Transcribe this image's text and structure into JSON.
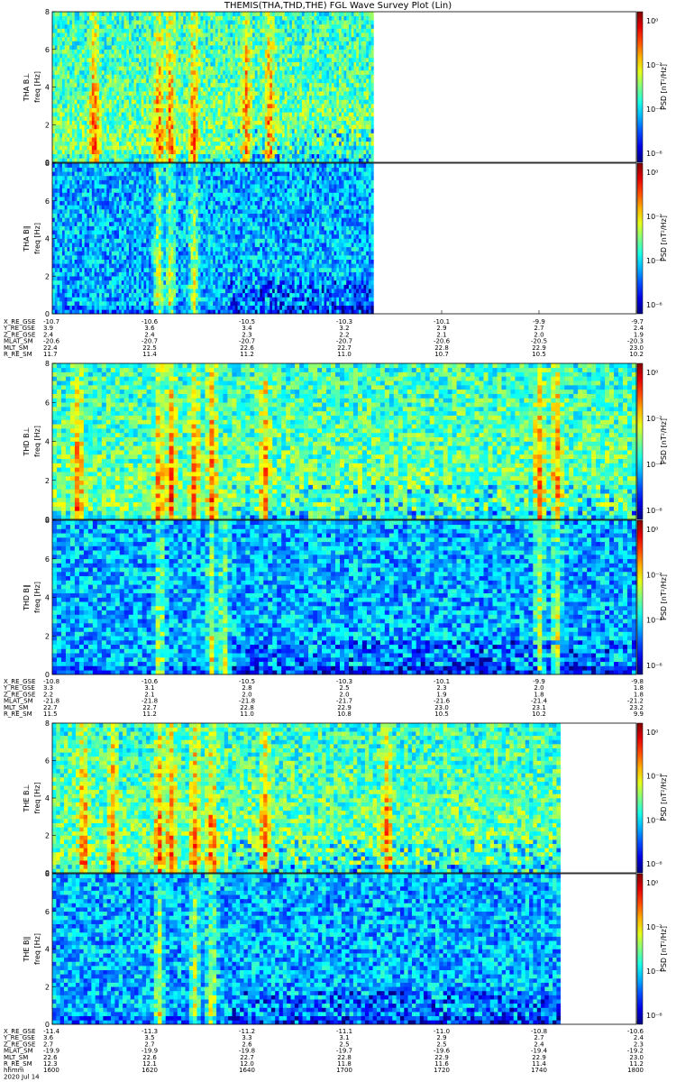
{
  "title": "THEMIS(THA,THD,THE) FGL Wave Survey Plot (Lin)",
  "colors": {
    "background": "#ffffff",
    "frame": "#000000",
    "blank": "#ffffff"
  },
  "chart_data": [
    {
      "type": "heatmap",
      "probe": "THA",
      "panels": [
        {
          "name": "tha-bperp",
          "ylabel": "THA B⊥",
          "yunit": "freq [Hz]",
          "ylim": [
            0,
            8
          ],
          "yticks": [
            "0",
            "2",
            "4",
            "6",
            "8"
          ],
          "colorbar_label": "PSD [nT²/Hz]",
          "colorbar_ticks": [
            "10⁰",
            "10⁻²",
            "10⁻⁴",
            "10⁻⁶"
          ],
          "data_coverage": 0.55,
          "intensity": "high",
          "bursts": [
            0.07,
            0.18,
            0.2,
            0.24,
            0.33,
            0.37
          ]
        },
        {
          "name": "tha-bpar",
          "ylabel": "THA B∥",
          "yunit": "freq [Hz]",
          "ylim": [
            0,
            8
          ],
          "yticks": [
            "0",
            "2",
            "4",
            "6",
            "8"
          ],
          "colorbar_label": "PSD [nT²/Hz]",
          "colorbar_ticks": [
            "10⁰",
            "10⁻²",
            "10⁻⁴",
            "10⁻⁶"
          ],
          "data_coverage": 0.55,
          "intensity": "low",
          "bursts": [
            0.18,
            0.2,
            0.24
          ]
        }
      ],
      "ephemeris_labels": [
        "X_RE_GSE",
        "Y_RE_GSE",
        "Z_RE_GSE",
        "MLAT_SM",
        "MLT_SM",
        "R_RE_SM"
      ],
      "ephemeris_columns": [
        [
          "-10.7",
          "-10.6",
          "-10.5",
          "-10.3",
          "-10.1",
          "-9.9",
          "-9.7"
        ],
        [
          "3.9",
          "3.6",
          "3.4",
          "3.2",
          "2.9",
          "2.7",
          "2.4"
        ],
        [
          "2.4",
          "2.4",
          "2.3",
          "2.2",
          "2.1",
          "2.0",
          "1.9"
        ],
        [
          "-20.6",
          "-20.7",
          "-20.7",
          "-20.7",
          "-20.6",
          "-20.5",
          "-20.3"
        ],
        [
          "22.4",
          "22.5",
          "22.6",
          "22.7",
          "22.8",
          "22.9",
          "23.0"
        ],
        [
          "11.7",
          "11.4",
          "11.2",
          "11.0",
          "10.7",
          "10.5",
          "10.2"
        ]
      ]
    },
    {
      "type": "heatmap",
      "probe": "THD",
      "panels": [
        {
          "name": "thd-bperp",
          "ylabel": "THD B⊥",
          "yunit": "freq [Hz]",
          "ylim": [
            0,
            8
          ],
          "yticks": [
            "0",
            "2",
            "4",
            "6",
            "8"
          ],
          "colorbar_label": "PSD [nT²/Hz]",
          "colorbar_ticks": [
            "10⁰",
            "10⁻²",
            "10⁻⁴",
            "10⁻⁶"
          ],
          "data_coverage": 1.0,
          "intensity": "high",
          "bursts": [
            0.04,
            0.18,
            0.2,
            0.24,
            0.27,
            0.36,
            0.83,
            0.86
          ]
        },
        {
          "name": "thd-bpar",
          "ylabel": "THD B∥",
          "yunit": "freq [Hz]",
          "ylim": [
            0,
            8
          ],
          "yticks": [
            "0",
            "2",
            "4",
            "6",
            "8"
          ],
          "colorbar_label": "PSD [nT²/Hz]",
          "colorbar_ticks": [
            "10⁰",
            "10⁻²",
            "10⁻⁴",
            "10⁻⁶"
          ],
          "data_coverage": 1.0,
          "intensity": "low",
          "bursts": [
            0.18,
            0.27,
            0.29,
            0.83,
            0.86
          ]
        }
      ],
      "ephemeris_labels": [
        "X_RE_GSE",
        "Y_RE_GSE",
        "Z_RE_GSE",
        "MLAT_SM",
        "MLT_SM",
        "R_RE_SM"
      ],
      "ephemeris_columns": [
        [
          "-10.8",
          "-10.6",
          "-10.5",
          "-10.3",
          "-10.1",
          "-9.9",
          "-9.8"
        ],
        [
          "3.3",
          "3.1",
          "2.8",
          "2.5",
          "2.3",
          "2.0",
          "1.8"
        ],
        [
          "2.2",
          "2.1",
          "2.0",
          "2.0",
          "1.9",
          "1.8",
          "1.8"
        ],
        [
          "-21.8",
          "-21.8",
          "-21.8",
          "-21.7",
          "-21.6",
          "-21.4",
          "-21.2"
        ],
        [
          "22.7",
          "22.7",
          "22.8",
          "22.9",
          "23.0",
          "23.1",
          "23.2"
        ],
        [
          "11.5",
          "11.2",
          "11.0",
          "10.8",
          "10.5",
          "10.2",
          "9.9"
        ]
      ]
    },
    {
      "type": "heatmap",
      "probe": "THE",
      "panels": [
        {
          "name": "the-bperp",
          "ylabel": "THE B⊥",
          "yunit": "freq [Hz]",
          "ylim": [
            0,
            8
          ],
          "yticks": [
            "0",
            "2",
            "4",
            "6",
            "8"
          ],
          "colorbar_label": "PSD [nT²/Hz]",
          "colorbar_ticks": [
            "10⁰",
            "10⁻²",
            "10⁻⁴",
            "10⁻⁶"
          ],
          "data_coverage": 0.87,
          "intensity": "high",
          "bursts": [
            0.05,
            0.1,
            0.18,
            0.2,
            0.24,
            0.27,
            0.36,
            0.57
          ]
        },
        {
          "name": "the-bpar",
          "ylabel": "THE B∥",
          "yunit": "freq [Hz]",
          "ylim": [
            0,
            8
          ],
          "yticks": [
            "0",
            "2",
            "4",
            "6",
            "8"
          ],
          "colorbar_label": "PSD [nT²/Hz]",
          "colorbar_ticks": [
            "10⁰",
            "10⁻²",
            "10⁻⁴",
            "10⁻⁶"
          ],
          "data_coverage": 0.87,
          "intensity": "low",
          "bursts": [
            0.18,
            0.24,
            0.27
          ]
        }
      ],
      "ephemeris_labels": [
        "X_RE_GSE",
        "Y_RE_GSE",
        "Z_RE_GSE",
        "MLAT_SM",
        "MLT_SM",
        "R_RE_SM",
        "hhmm",
        "2020 Jul 14"
      ],
      "ephemeris_columns": [
        [
          "-11.4",
          "-11.3",
          "-11.2",
          "-11.1",
          "-11.0",
          "-10.8",
          "-10.6"
        ],
        [
          "3.6",
          "3.5",
          "3.3",
          "3.1",
          "2.9",
          "2.7",
          "2.4"
        ],
        [
          "2.7",
          "2.7",
          "2.6",
          "2.5",
          "2.5",
          "2.4",
          "2.3"
        ],
        [
          "-19.9",
          "-19.9",
          "-19.8",
          "-19.7",
          "-19.6",
          "-19.4",
          "-19.2"
        ],
        [
          "22.6",
          "22.6",
          "22.7",
          "22.8",
          "22.9",
          "22.9",
          "23.0"
        ],
        [
          "12.3",
          "12.1",
          "12.0",
          "11.8",
          "11.6",
          "11.4",
          "11.2"
        ],
        [
          "1600",
          "1620",
          "1640",
          "1700",
          "1720",
          "1740",
          "1800"
        ]
      ]
    }
  ]
}
